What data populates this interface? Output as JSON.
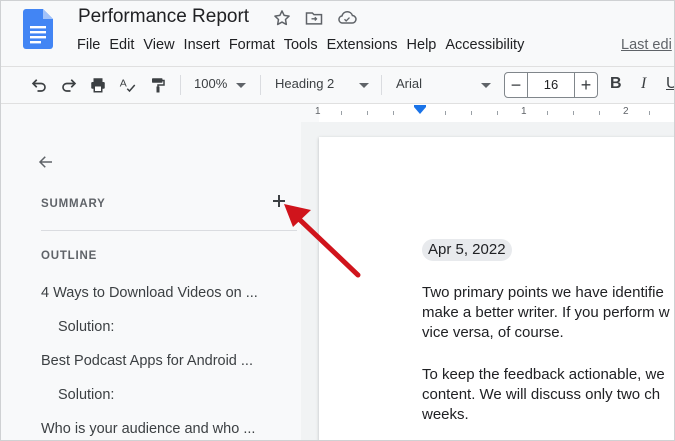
{
  "header": {
    "title": "Performance Report",
    "menu": [
      "File",
      "Edit",
      "View",
      "Insert",
      "Format",
      "Tools",
      "Extensions",
      "Help",
      "Accessibility"
    ],
    "last_edit": "Last edi",
    "icons": [
      "docs-logo-icon",
      "star-icon",
      "move-folder-icon",
      "cloud-status-icon"
    ]
  },
  "toolbar": {
    "zoom": "100%",
    "style": "Heading 2",
    "font": "Arial",
    "font_size": "16",
    "minus": "−",
    "plus": "+",
    "bold": "B",
    "italic": "I",
    "underline": "U"
  },
  "ruler": {
    "labels": [
      "1",
      "1",
      "2"
    ]
  },
  "sidepanel": {
    "summary_heading": "SUMMARY",
    "add_summary": "+",
    "outline_heading": "OUTLINE",
    "outline": [
      "4 Ways to Download Videos on ...",
      "Solution:",
      "Best Podcast Apps for Android ...",
      "Solution:",
      "Who is your audience and who ..."
    ]
  },
  "document": {
    "date": "Apr 5, 2022",
    "paragraph1": [
      "Two primary points we have identifie",
      "make a better writer. If you perform w",
      "vice versa, of course."
    ],
    "paragraph2": [
      "To keep the feedback actionable, we",
      "content. We will discuss only two ch",
      "weeks."
    ]
  },
  "colors": {
    "accent": "#1a73e8",
    "annotation_arrow": "#d0141c",
    "docs_blue": "#4285f4"
  }
}
